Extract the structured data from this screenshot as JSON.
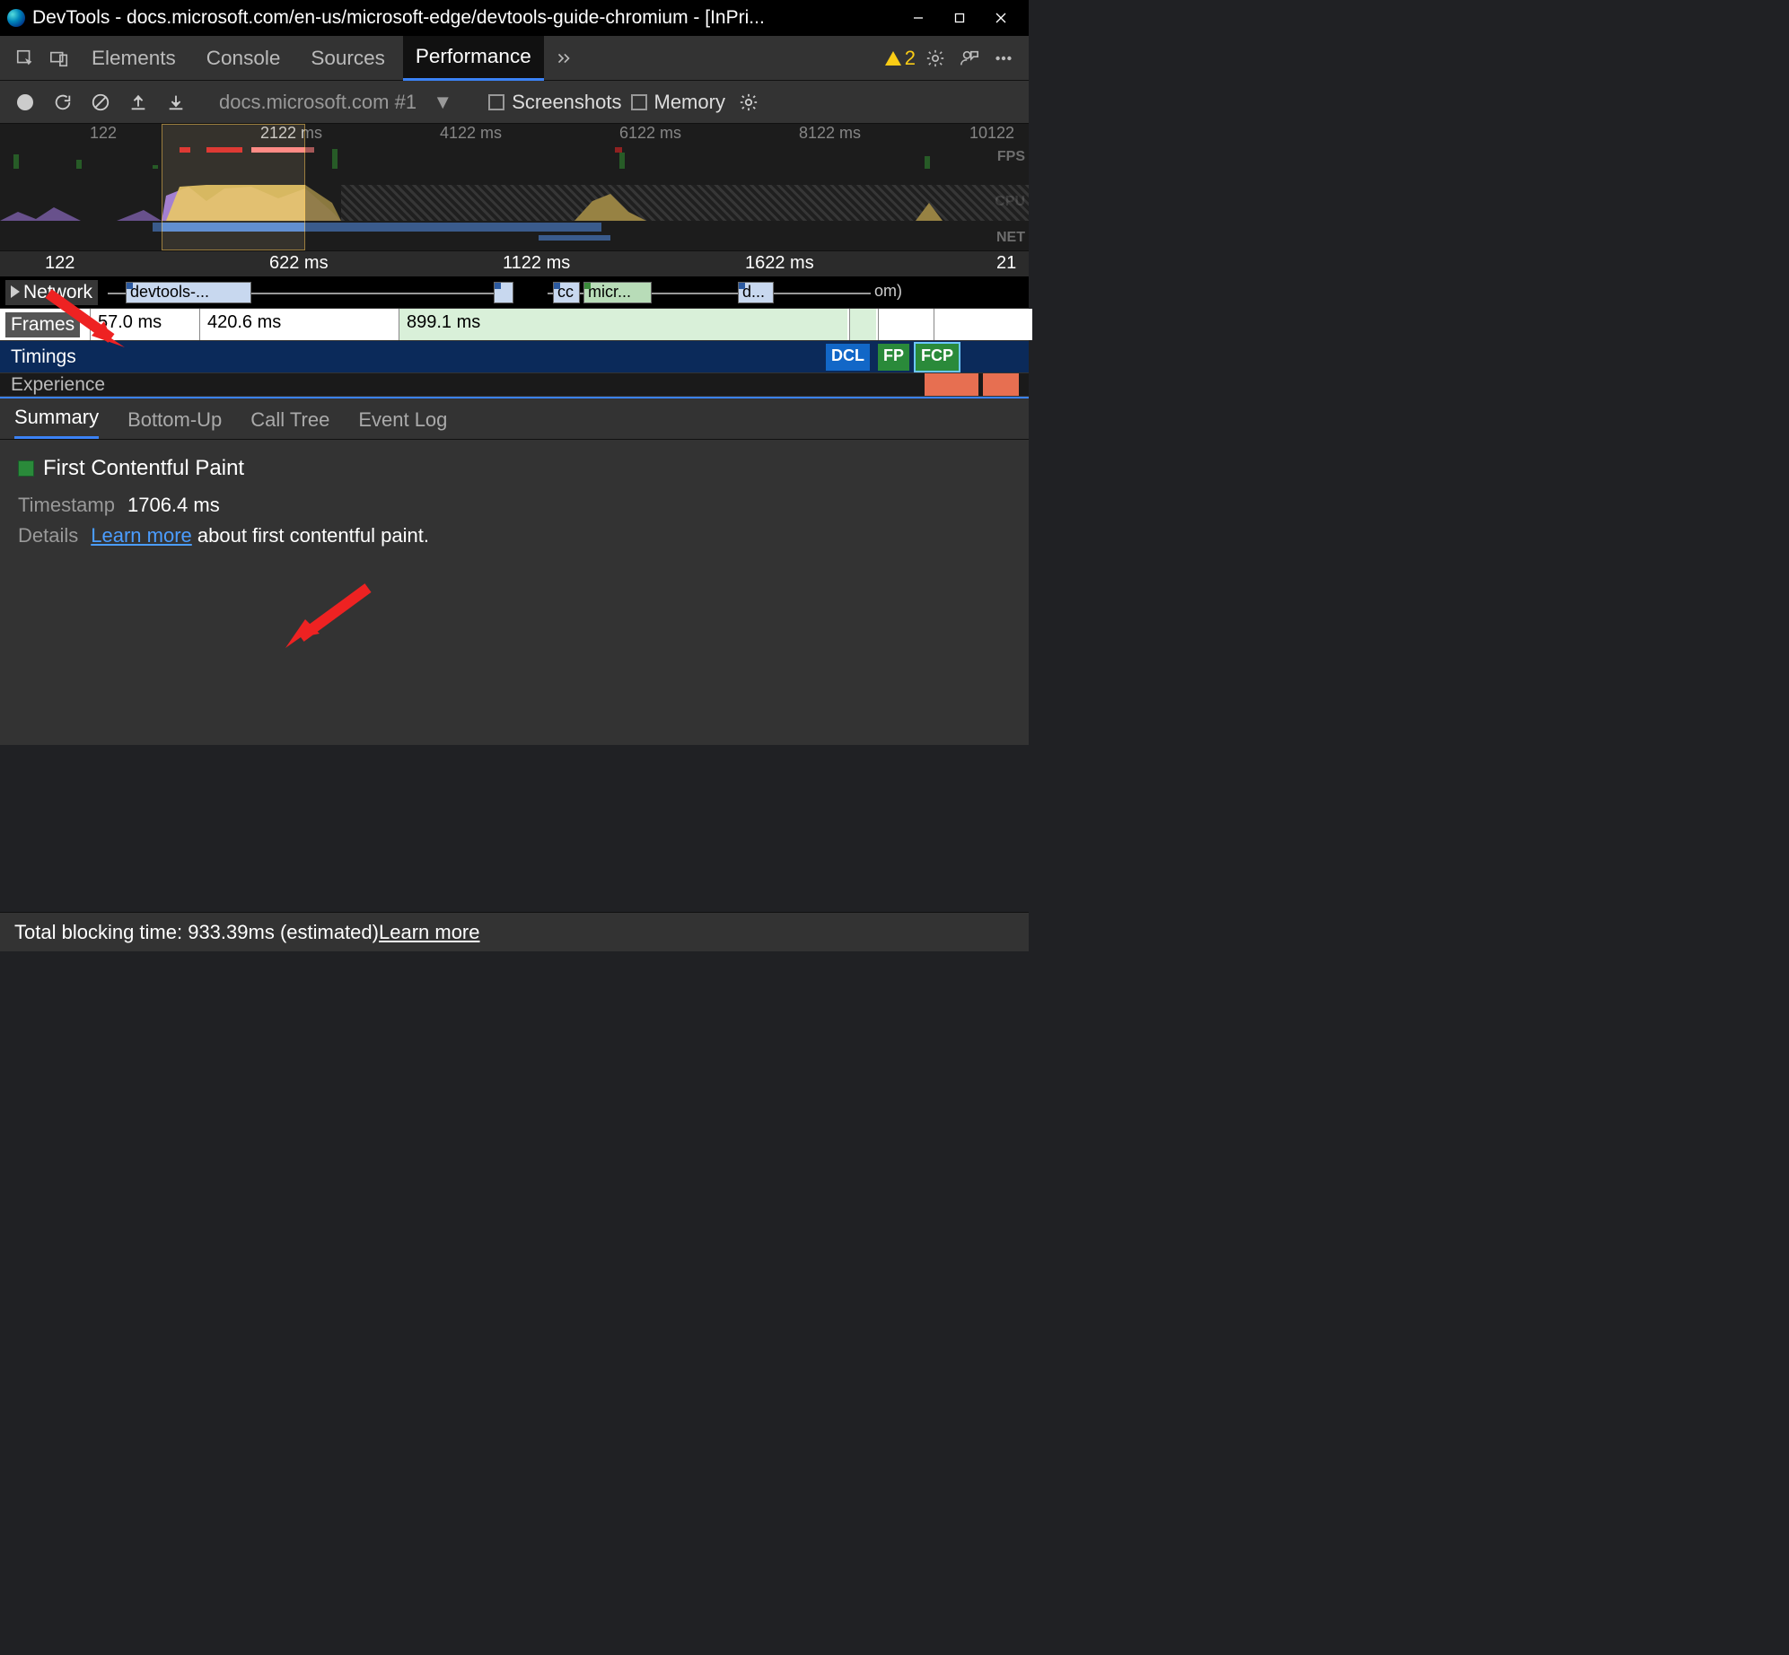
{
  "window": {
    "title": "DevTools - docs.microsoft.com/en-us/microsoft-edge/devtools-guide-chromium - [InPri..."
  },
  "tabs": {
    "items": [
      "Elements",
      "Console",
      "Sources",
      "Performance"
    ],
    "active": 3,
    "warn_count": "2"
  },
  "perf_toolbar": {
    "recording_label": "docs.microsoft.com #1",
    "screenshots_label": "Screenshots",
    "memory_label": "Memory"
  },
  "overview": {
    "ticks": [
      "122",
      "2122 ms",
      "4122 ms",
      "6122 ms",
      "8122 ms",
      "10122"
    ],
    "labels": {
      "fps": "FPS",
      "cpu": "CPU",
      "net": "NET"
    }
  },
  "flame": {
    "ticks": [
      "122",
      "622 ms",
      "1122 ms",
      "1622 ms",
      "21"
    ],
    "network_label": "Network",
    "frames_label": "Frames",
    "timings_label": "Timings",
    "experience_label": "Experience",
    "network_blocks": [
      "devtools-...",
      "cc",
      "micr...",
      "d...",
      "om)"
    ],
    "frame_blocks": [
      "57.0 ms",
      "420.6 ms",
      "899.1 ms"
    ],
    "timing_blocks": [
      "DCL",
      "FP",
      "FCP"
    ]
  },
  "summary_tabs": [
    "Summary",
    "Bottom-Up",
    "Call Tree",
    "Event Log"
  ],
  "summary": {
    "title": "First Contentful Paint",
    "timestamp_label": "Timestamp",
    "timestamp_value": "1706.4 ms",
    "details_label": "Details",
    "learn_more": "Learn more",
    "details_text": " about first contentful paint."
  },
  "footer": {
    "tbt_prefix": "Total blocking time: ",
    "tbt_value": "933.39ms",
    "tbt_suffix": " (estimated) ",
    "learn_more": "Learn more"
  }
}
